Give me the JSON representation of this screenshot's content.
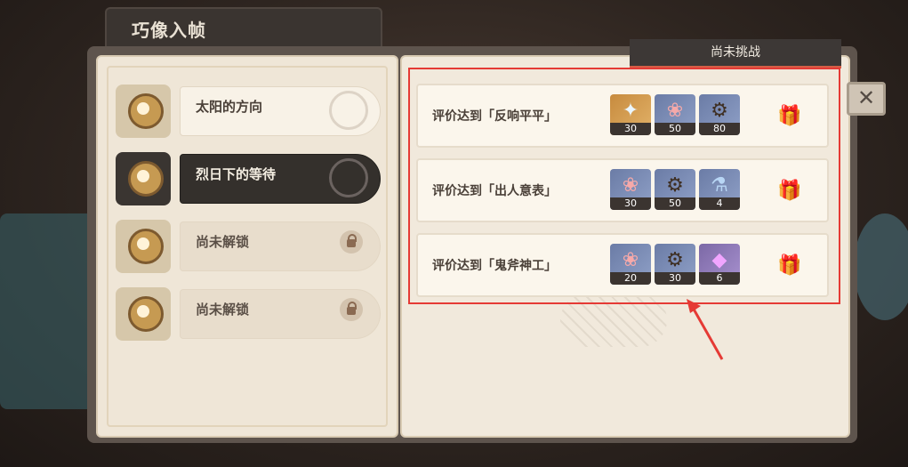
{
  "header": {
    "title": "巧像入帧"
  },
  "status": {
    "label": "尚未挑战"
  },
  "levels": [
    {
      "name": "太阳的方向",
      "state": "normal"
    },
    {
      "name": "烈日下的等待",
      "state": "active"
    },
    {
      "name": "尚未解锁",
      "state": "locked"
    },
    {
      "name": "尚未解锁",
      "state": "locked"
    }
  ],
  "rewards": [
    {
      "title": "评价达到「反响平平」",
      "items": [
        {
          "icon": "star-crystal-icon",
          "rarity": "gold",
          "qty": "30"
        },
        {
          "icon": "pink-flower-icon",
          "rarity": "blue",
          "qty": "50"
        },
        {
          "icon": "gear-coin-icon",
          "rarity": "blue",
          "qty": "80"
        }
      ]
    },
    {
      "title": "评价达到「出人意表」",
      "items": [
        {
          "icon": "pink-flower-icon",
          "rarity": "blue",
          "qty": "30"
        },
        {
          "icon": "gear-coin-icon",
          "rarity": "blue",
          "qty": "50"
        },
        {
          "icon": "potion-icon",
          "rarity": "blue",
          "qty": "4"
        }
      ]
    },
    {
      "title": "评价达到「鬼斧神工」",
      "items": [
        {
          "icon": "pink-flower-icon",
          "rarity": "blue",
          "qty": "20"
        },
        {
          "icon": "gear-coin-icon",
          "rarity": "blue",
          "qty": "30"
        },
        {
          "icon": "purple-crystal-icon",
          "rarity": "purple",
          "qty": "6"
        }
      ]
    }
  ],
  "colors": {
    "highlight": "#e53a35",
    "active_bg": "#34302c",
    "panel_bg": "#f1e9dc"
  }
}
